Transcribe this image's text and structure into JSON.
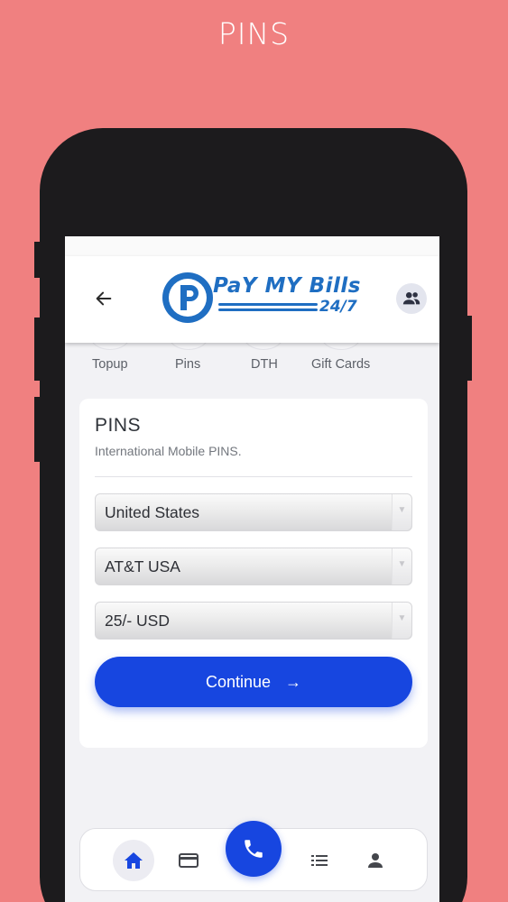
{
  "page_heading": "PINS",
  "header": {
    "logo_text": "PaY MY Bills",
    "logo_suffix": "24/7"
  },
  "categories": [
    {
      "label": "Topup"
    },
    {
      "label": "Pins"
    },
    {
      "label": "DTH"
    },
    {
      "label": "Gift Cards"
    }
  ],
  "card": {
    "title": "PINS",
    "subtitle": "International Mobile PINS."
  },
  "form": {
    "country": "United States",
    "operator": "AT&T USA",
    "amount": "25/- USD",
    "continue_label": "Continue",
    "continue_arrow": "→"
  },
  "bottom_nav": {
    "items": [
      "home-icon",
      "card-icon",
      "phone-icon",
      "list-icon",
      "person-icon"
    ],
    "active": "home-icon"
  },
  "colors": {
    "background": "#f08080",
    "primary": "#1746e0",
    "logo_blue": "#1f6ec2"
  }
}
